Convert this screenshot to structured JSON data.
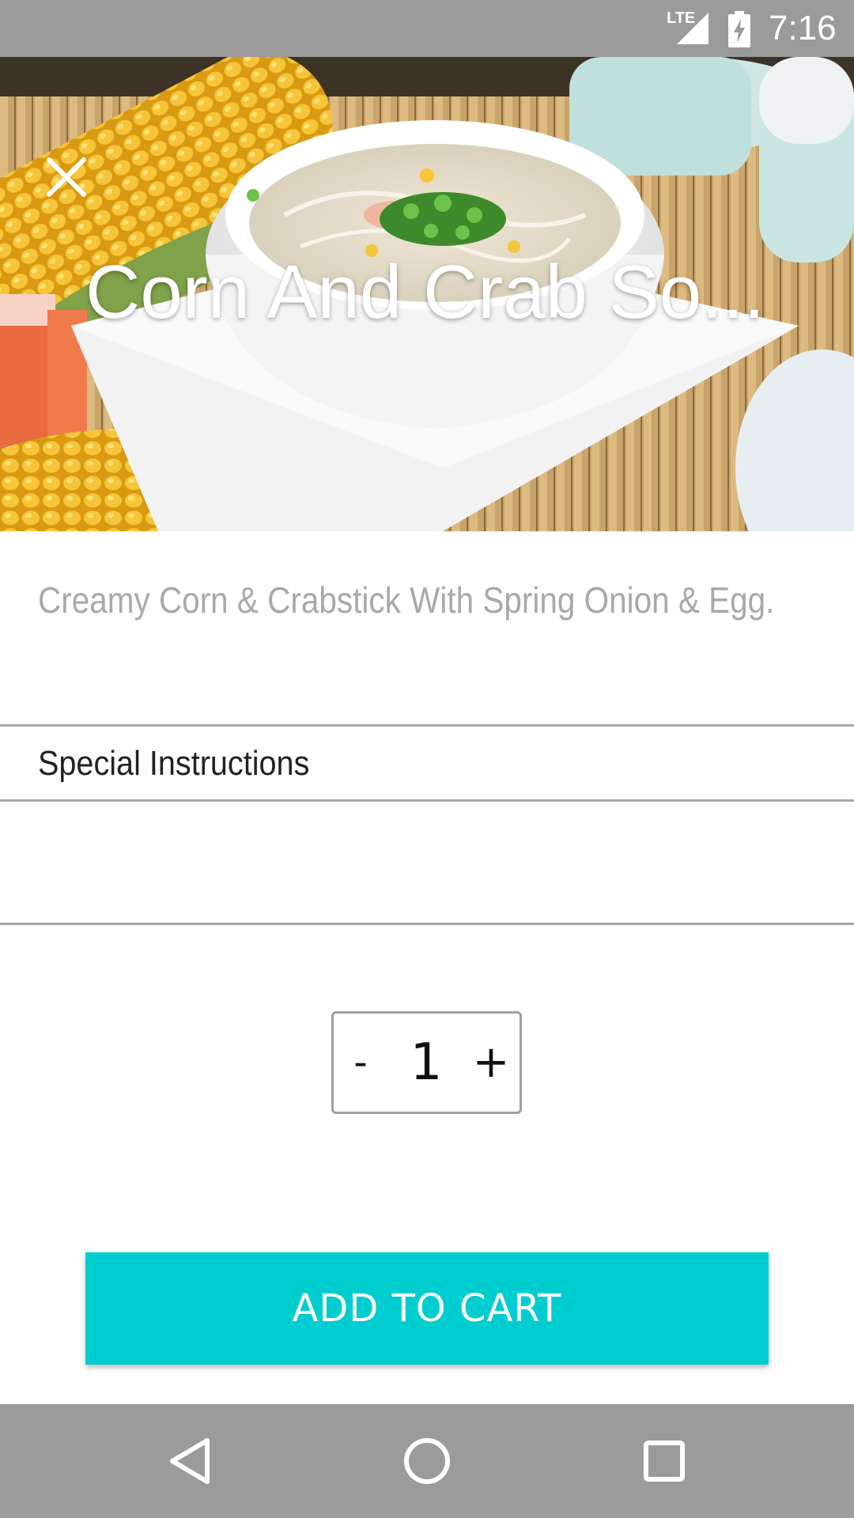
{
  "status_bar": {
    "network": "LTE",
    "time": "7:16"
  },
  "item": {
    "title": "Corn And Crab So...",
    "description": "Creamy Corn & Crabstick With Spring Onion & Egg.",
    "image_alt": "Corn and crab soup bowl with corn cob and crabsticks"
  },
  "special_instructions": {
    "label": "Special Instructions",
    "value": ""
  },
  "quantity": {
    "minus_label": "-",
    "value": "1",
    "plus_label": "+"
  },
  "add_to_cart": {
    "label": "ADD TO CART"
  },
  "colors": {
    "accent": "#00cdd0",
    "system_bar": "#9b9b9b",
    "description_text": "#a9a9a9",
    "divider": "#a8a8a8"
  },
  "icons": {
    "close": "close-icon",
    "signal": "signal-icon",
    "battery": "battery-charging-icon",
    "back": "back-icon",
    "home": "home-icon",
    "recents": "recents-icon"
  }
}
